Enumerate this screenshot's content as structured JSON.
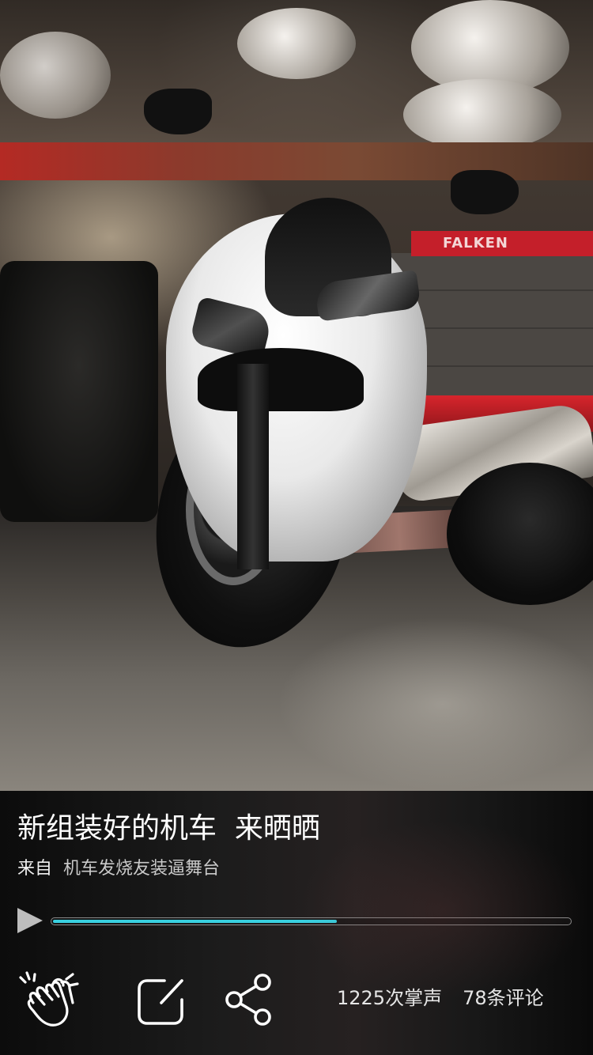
{
  "post": {
    "title": "新组装好的机车  来晒晒",
    "source_label": "来自",
    "source_group": "机车发烧友装逼舞台",
    "image_icon": "motorcycle-photo"
  },
  "player": {
    "play_icon": "play-icon",
    "progress_fraction": 0.55,
    "colors": {
      "progress_fill": "#39d0e0",
      "track_border": "#8a8a8a"
    }
  },
  "actions": {
    "clap_icon": "clapping-hands-icon",
    "edit_icon": "edit-square-icon",
    "share_icon": "share-nodes-icon",
    "applause_count": "1225次掌声",
    "comment_count": "78条评论"
  },
  "photo_signage": {
    "brand_text": "FALKEN"
  }
}
